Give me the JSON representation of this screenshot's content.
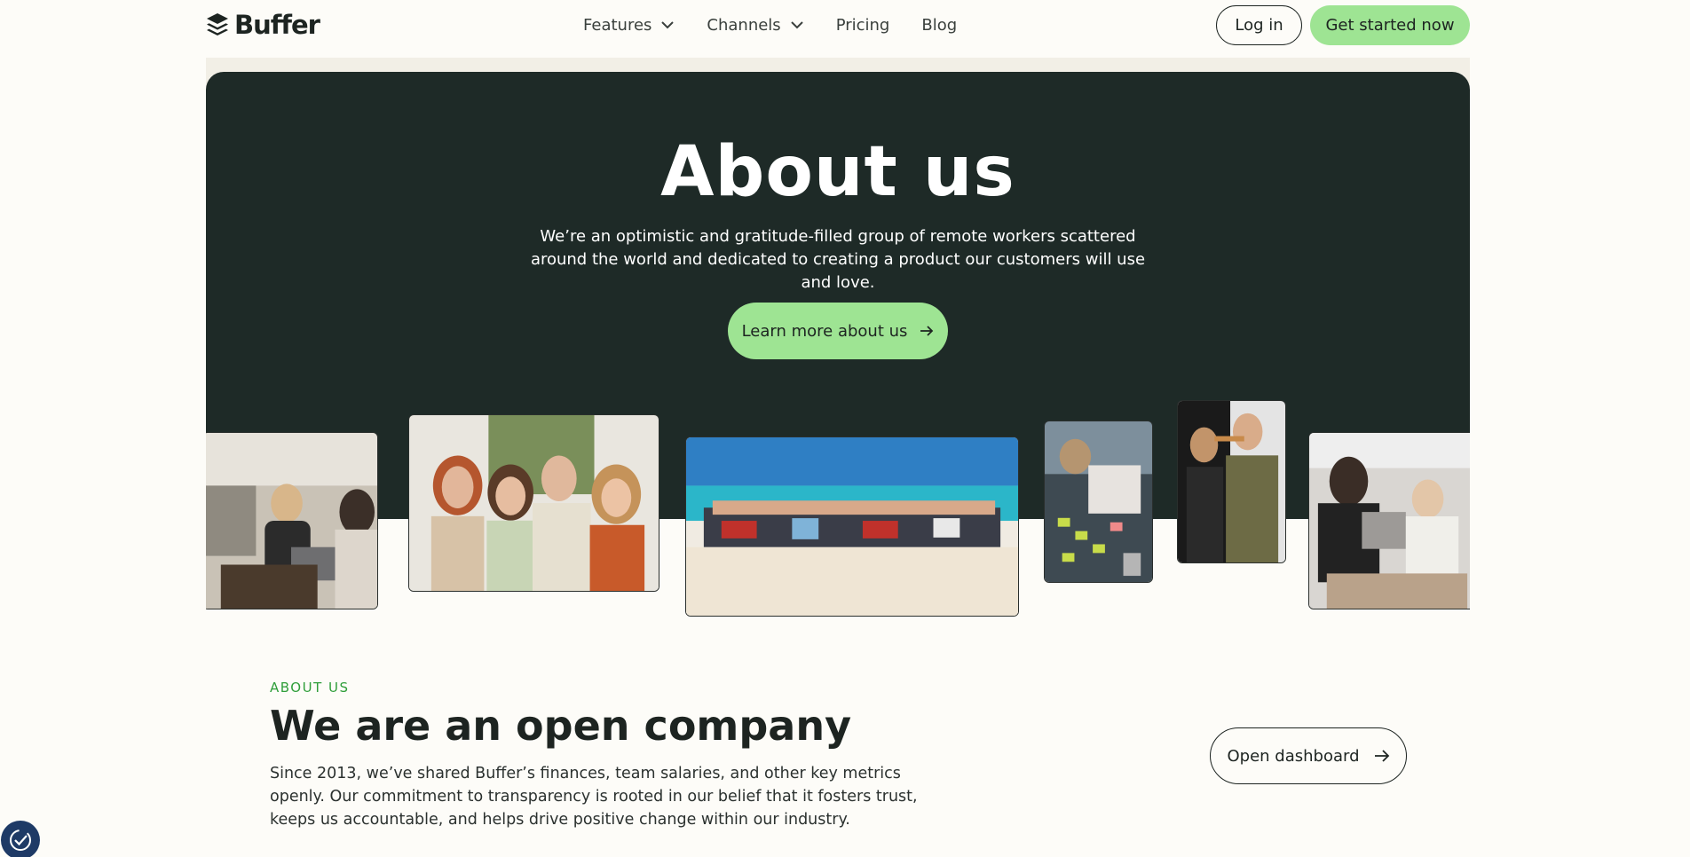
{
  "header": {
    "logo_text": "Buffer",
    "nav": [
      {
        "label": "Features",
        "has_dropdown": true
      },
      {
        "label": "Channels",
        "has_dropdown": true
      },
      {
        "label": "Pricing",
        "has_dropdown": false
      },
      {
        "label": "Blog",
        "has_dropdown": false
      }
    ],
    "login_label": "Log in",
    "cta_label": "Get started now"
  },
  "hero": {
    "title": "About us",
    "subtitle": "We’re an optimistic and gratitude-filled group of remote workers scattered around the world and dedicated to creating a product our customers will use and love.",
    "button_label": "Learn more about us"
  },
  "about": {
    "eyebrow": "ABOUT US",
    "title": "We are an open company",
    "body": "Since 2013, we’ve shared Buffer’s finances, team salaries, and other key metrics openly. Our commitment to transparency is rooted in our belief that it fosters trust, keeps us accountable, and helps drive positive change within our industry.",
    "button_label": "Open dashboard"
  },
  "colors": {
    "accent_green": "#9ee493",
    "hero_bg": "#1e2a27",
    "page_bg": "#fdfcf8",
    "eyebrow_green": "#2f9e3a"
  },
  "icons": {
    "logo": "buffer-stack-icon",
    "dropdown": "chevron-down-icon",
    "arrow": "arrow-right-icon",
    "consent": "cookie-consent-icon"
  }
}
